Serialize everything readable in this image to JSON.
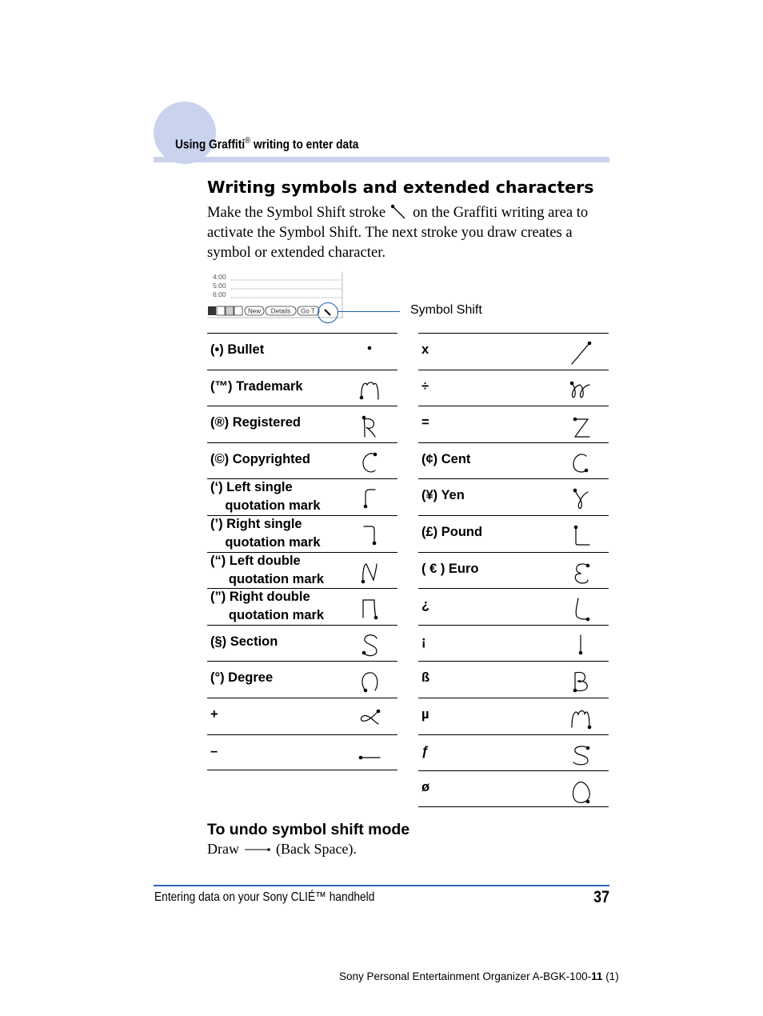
{
  "header": {
    "section_title": "Using Graffiti",
    "registered_mark": "®",
    "section_title_rest": " writing to enter data",
    "accent_color": "#c9d3ee"
  },
  "main": {
    "title": "Writing symbols and extended characters",
    "intro_before_icon": "Make the Symbol Shift stroke",
    "intro_after_icon": "on the Graffiti writing area to activate the Symbol Shift. The next stroke you draw creates a symbol or extended character.",
    "screenshot": {
      "times": [
        "4:00",
        "5:00",
        "6:00"
      ],
      "buttons": [
        "New",
        "Details",
        "Go T"
      ],
      "callout_label": "Symbol Shift",
      "callout_color": "#1f5fb0"
    },
    "left_table": [
      {
        "label": "(•) Bullet",
        "stroke": "dot"
      },
      {
        "label": "(™) Trademark",
        "stroke": "m-left-dot"
      },
      {
        "label": "(®) Registered",
        "stroke": "r"
      },
      {
        "label": "(©) Copyrighted",
        "stroke": "c-top-dot"
      },
      {
        "label": "(‘) Left single\n    quotation mark",
        "stroke": "left-single"
      },
      {
        "label": "(’) Right single\n    quotation mark",
        "stroke": "right-single"
      },
      {
        "label": "(“) Left double\n     quotation mark",
        "stroke": "n"
      },
      {
        "label": "(”) Right double\n     quotation mark",
        "stroke": "reverse-n"
      },
      {
        "label": "(§) Section",
        "stroke": "s"
      },
      {
        "label": "(°) Degree",
        "stroke": "o"
      },
      {
        "label": "+",
        "stroke": "alpha"
      },
      {
        "label": "–",
        "stroke": "dash"
      }
    ],
    "right_table": [
      {
        "label": "x",
        "stroke": "slash"
      },
      {
        "label": "÷",
        "stroke": "double-loop"
      },
      {
        "label": "=",
        "stroke": "z"
      },
      {
        "label": "(¢) Cent",
        "stroke": "c-bottom-dot"
      },
      {
        "label": "(¥) Yen",
        "stroke": "y"
      },
      {
        "label": "(£) Pound",
        "stroke": "l"
      },
      {
        "label": "( € ) Euro",
        "stroke": "e"
      },
      {
        "label": "¿",
        "stroke": "l-bottom-dot"
      },
      {
        "label": "¡",
        "stroke": "vertical"
      },
      {
        "label": "ß",
        "stroke": "b"
      },
      {
        "label": "µ",
        "stroke": "m-right-dot"
      },
      {
        "label": "ƒ",
        "stroke": "s-top-dot"
      },
      {
        "label": "ø",
        "stroke": "o-right"
      }
    ],
    "undo_title": "To undo symbol shift mode",
    "undo_before": "Draw",
    "undo_after": "(Back Space)."
  },
  "footer": {
    "text": "Entering data on your Sony CLIÉ™ handheld",
    "page_number": "37",
    "doc_id_prefix": "Sony Personal Entertainment Organizer  A-BGK-100-",
    "doc_id_bold": "11",
    "doc_id_suffix": " (1)",
    "rule_color": "#2a66b8"
  }
}
